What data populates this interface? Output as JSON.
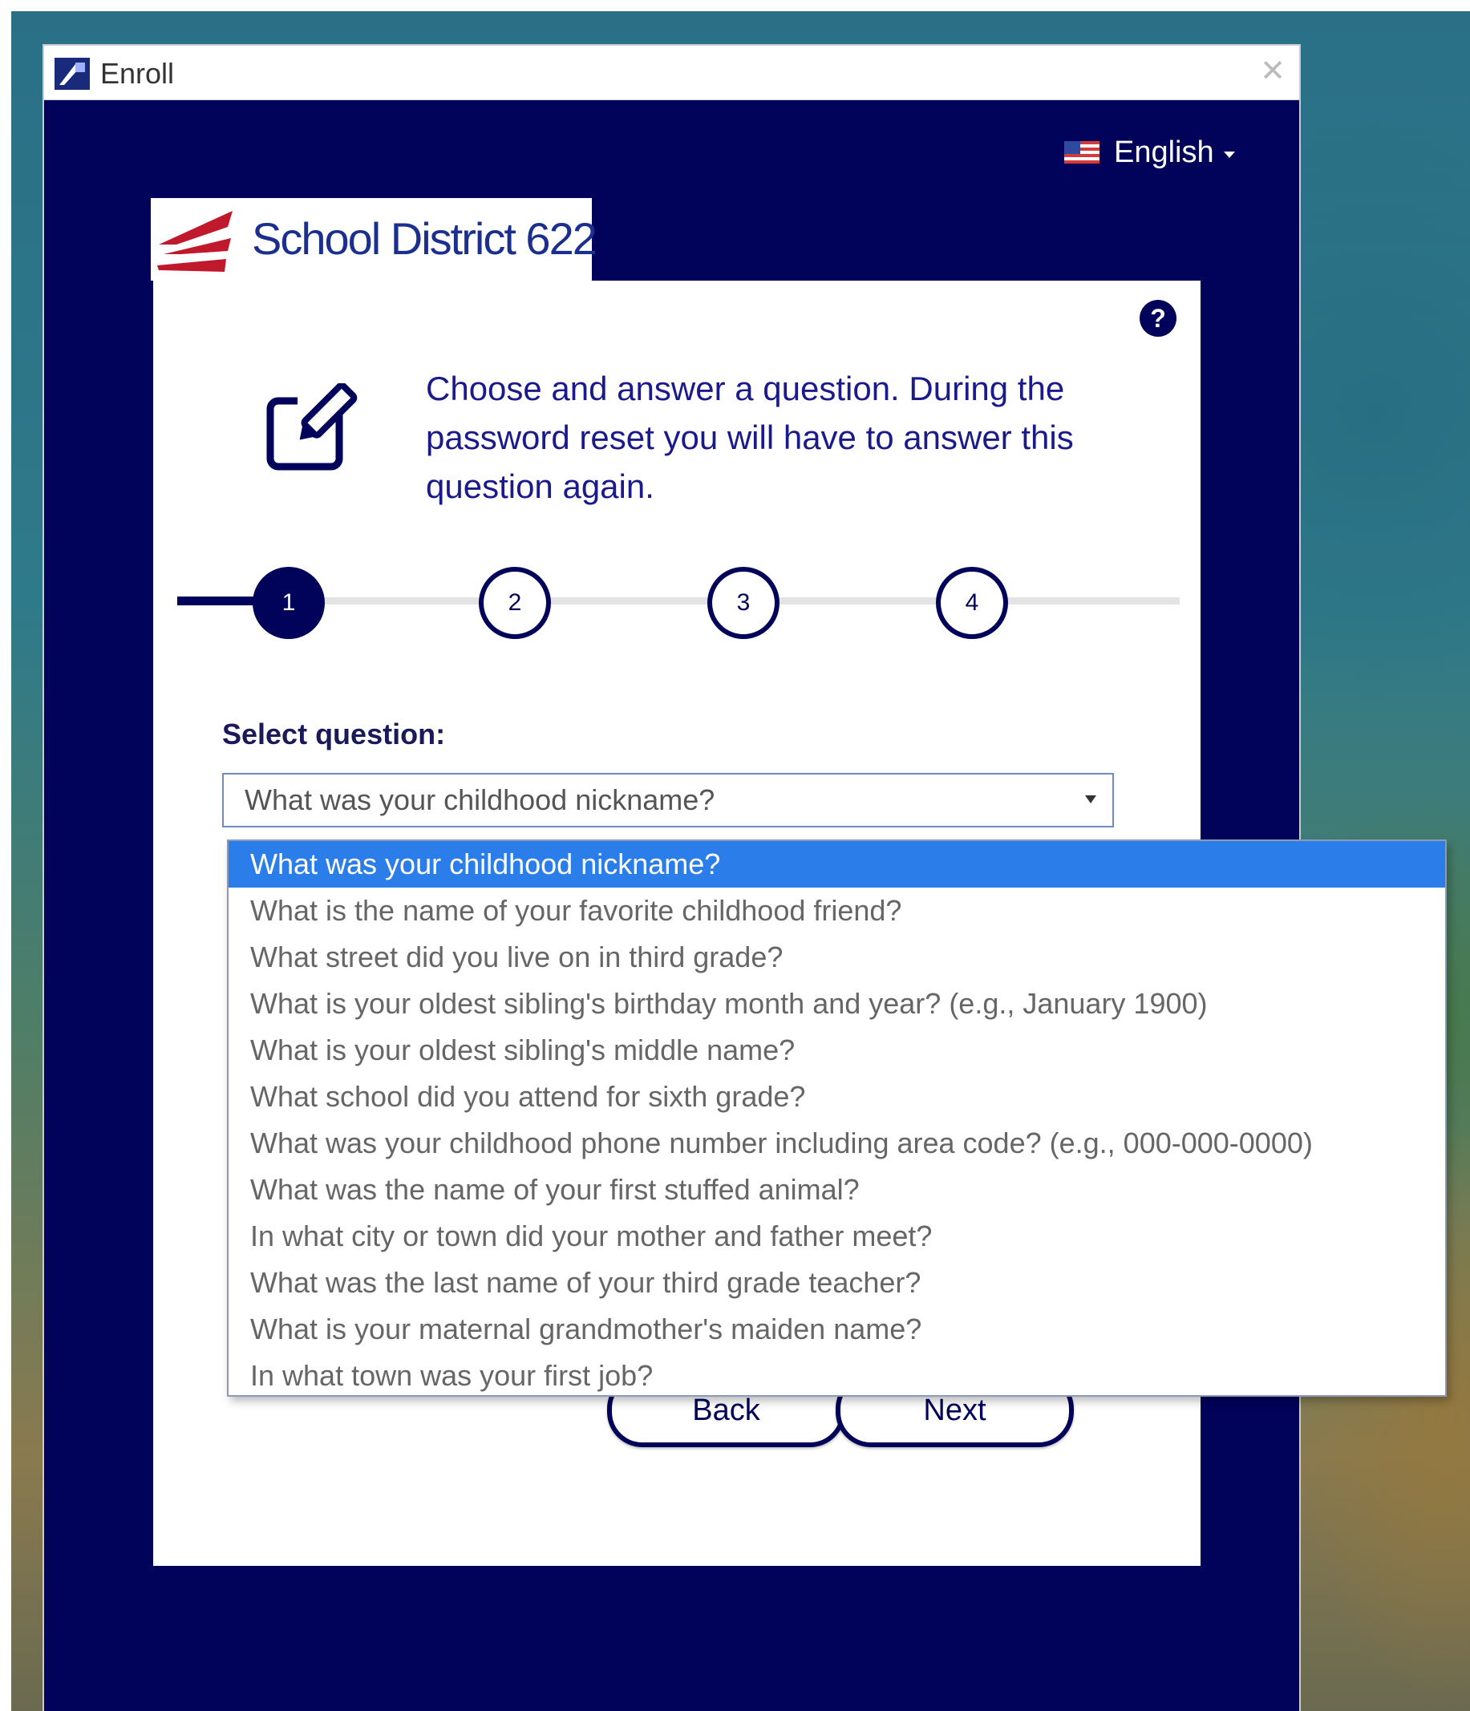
{
  "window": {
    "title": "Enroll",
    "close_glyph": "✕"
  },
  "language": {
    "label": "English",
    "flag_icon": "us-flag-icon"
  },
  "logo": {
    "text": "School District 622",
    "colors": {
      "mark": "#c0192c",
      "text": "#1b2f8f"
    }
  },
  "help_glyph": "?",
  "instructions": "Choose and answer a question. During the password reset you will have to answer this question again.",
  "stepper": {
    "steps": [
      "1",
      "2",
      "3",
      "4"
    ],
    "active_step": 1
  },
  "select_label": "Select question:",
  "select_value": "What was your childhood nickname?",
  "options": [
    "What was your childhood nickname?",
    "What is the name of your favorite childhood friend?",
    "What street did you live on in third grade?",
    "What is your oldest sibling's birthday month and year? (e.g., January 1900)",
    "What is your oldest sibling's middle name?",
    "What school did you attend for sixth grade?",
    "What was your childhood phone number including area code? (e.g., 000-000-0000)",
    "What was the name of your first stuffed animal?",
    "In what city or town did your mother and father meet?",
    "What was the last name of your third grade teacher?",
    "What is your maternal grandmother's maiden name?",
    "In what town was your first job?"
  ],
  "buttons": {
    "back": "Back",
    "next": "Next"
  },
  "colors": {
    "window_bg": "#010259",
    "accent": "#010259",
    "selected_option": "#2b7de9"
  }
}
